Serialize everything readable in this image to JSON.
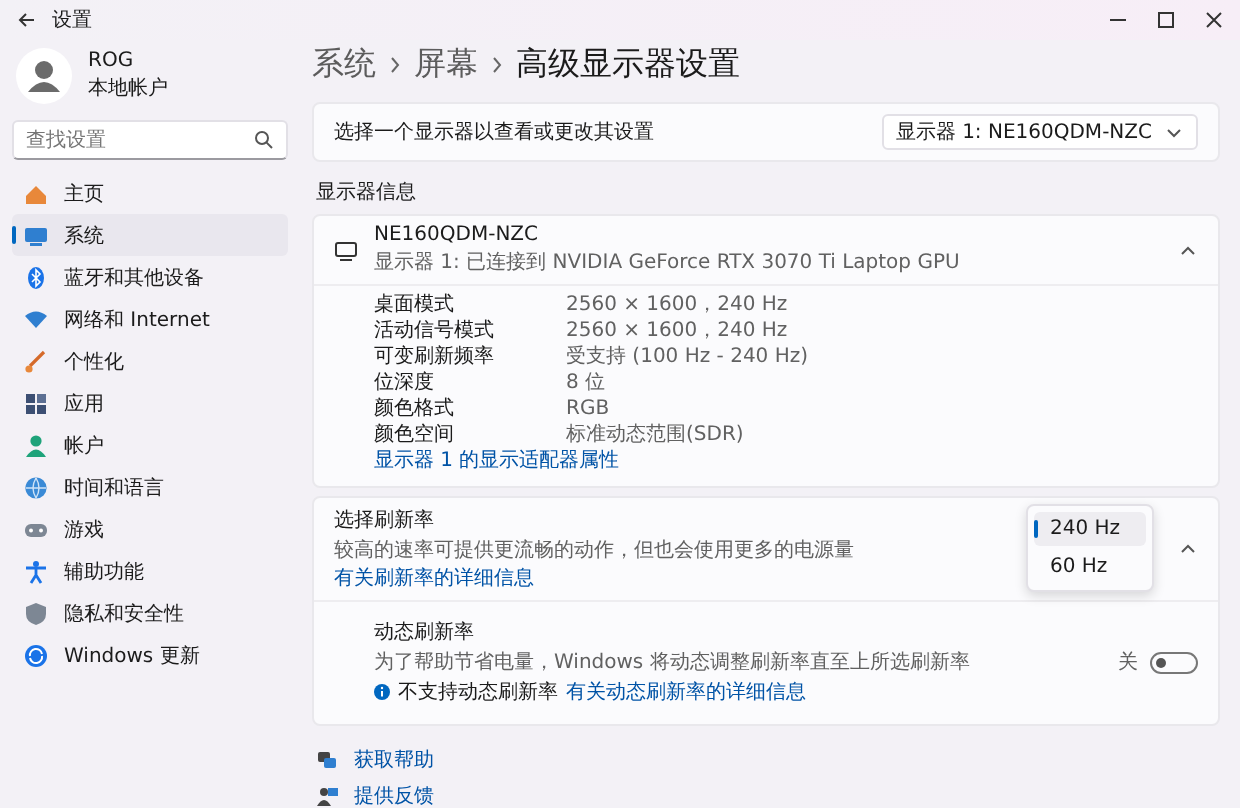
{
  "window": {
    "title": "设置"
  },
  "user": {
    "name": "ROG",
    "account": "本地帐户"
  },
  "search": {
    "placeholder": "查找设置"
  },
  "sidebar": {
    "items": [
      {
        "label": "主页",
        "selected": false
      },
      {
        "label": "系统",
        "selected": true
      },
      {
        "label": "蓝牙和其他设备",
        "selected": false
      },
      {
        "label": "网络和 Internet",
        "selected": false
      },
      {
        "label": "个性化",
        "selected": false
      },
      {
        "label": "应用",
        "selected": false
      },
      {
        "label": "帐户",
        "selected": false
      },
      {
        "label": "时间和语言",
        "selected": false
      },
      {
        "label": "游戏",
        "selected": false
      },
      {
        "label": "辅助功能",
        "selected": false
      },
      {
        "label": "隐私和安全性",
        "selected": false
      },
      {
        "label": "Windows 更新",
        "selected": false
      }
    ]
  },
  "breadcrumb": [
    "系统",
    "屏幕",
    "高级显示器设置"
  ],
  "display_select": {
    "label": "选择一个显示器以查看或更改其设置",
    "value": "显示器 1: NE160QDM-NZC"
  },
  "section_title": "显示器信息",
  "monitor": {
    "name": "NE160QDM-NZC",
    "subtitle": "显示器 1: 已连接到 NVIDIA GeForce RTX 3070 Ti Laptop GPU",
    "expanded": true,
    "properties": [
      {
        "label": "桌面模式",
        "value": "2560 × 1600，240 Hz"
      },
      {
        "label": "活动信号模式",
        "value": "2560 × 1600，240 Hz"
      },
      {
        "label": "可变刷新频率",
        "value": "受支持 (100 Hz - 240 Hz)"
      },
      {
        "label": "位深度",
        "value": "8 位"
      },
      {
        "label": "颜色格式",
        "value": "RGB"
      },
      {
        "label": "颜色空间",
        "value": "标准动态范围(SDR)"
      }
    ],
    "link": "显示器 1 的显示适配器属性"
  },
  "refresh": {
    "title": "选择刷新率",
    "description": "较高的速率可提供更流畅的动作，但也会使用更多的电源量",
    "link": "有关刷新率的详细信息",
    "expanded": true,
    "dropdown": {
      "expanded": true,
      "options": [
        {
          "label": "240 Hz",
          "selected": true
        },
        {
          "label": "60 Hz",
          "selected": false
        }
      ]
    },
    "dynamic": {
      "title": "动态刷新率",
      "description": "为了帮助节省电量，Windows 将动态调整刷新率直至上所选刷新率",
      "note": "不支持动态刷新率",
      "note_link": "有关动态刷新率的详细信息",
      "toggle": {
        "on": false,
        "label": "关"
      }
    }
  },
  "footer_links": [
    "获取帮助",
    "提供反馈"
  ]
}
